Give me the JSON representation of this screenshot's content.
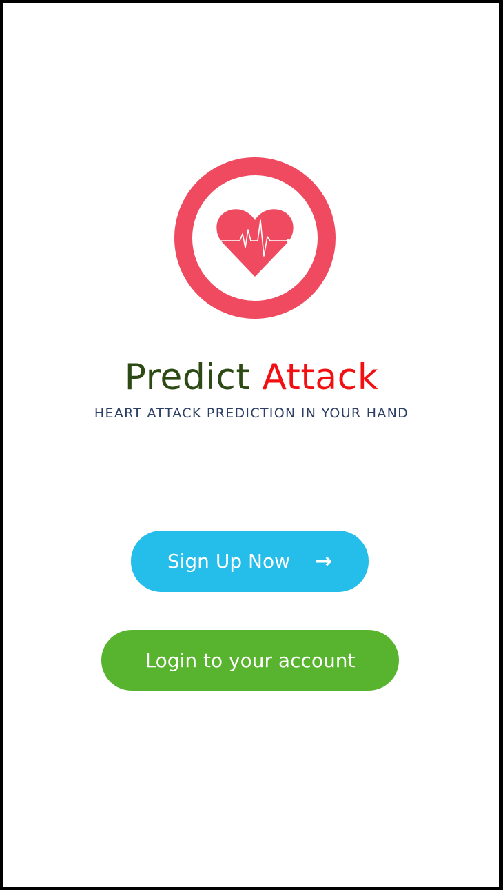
{
  "app": {
    "title_part1": "Predict",
    "title_part2": "Attack",
    "tagline": "HEART ATTACK PREDICTION IN YOUR HAND"
  },
  "logo": {
    "icon": "heart-pulse-icon",
    "ring_color": "#ef4a60",
    "heart_color": "#ef4a60"
  },
  "buttons": {
    "signup_label": "Sign Up Now",
    "signup_arrow": "→",
    "login_label": "Login to your account"
  },
  "colors": {
    "title_primary": "#2d4a14",
    "title_accent": "#f20f12",
    "tagline": "#2c3e64",
    "signup_bg": "#25bde9",
    "login_bg": "#58b42f"
  }
}
